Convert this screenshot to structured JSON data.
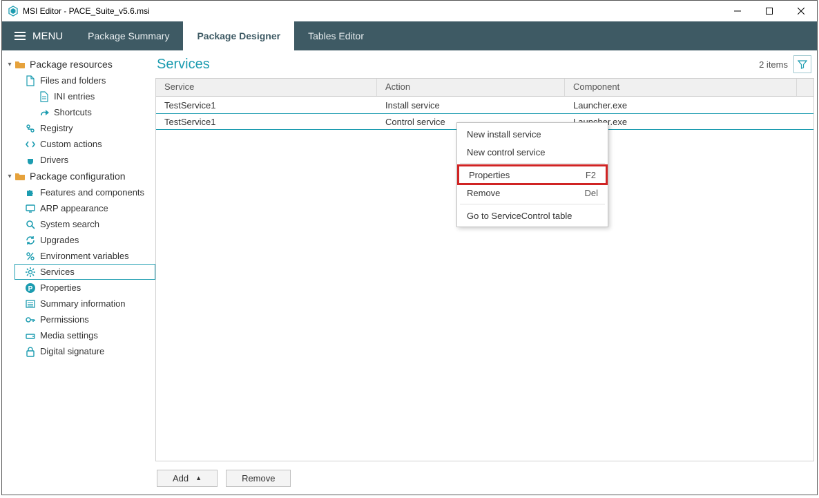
{
  "window": {
    "title": "MSI Editor - PACE_Suite_v5.6.msi"
  },
  "menubar": {
    "menu_label": "MENU",
    "tabs": [
      {
        "label": "Package Summary"
      },
      {
        "label": "Package Designer"
      },
      {
        "label": "Tables Editor"
      }
    ],
    "active_tab_index": 1
  },
  "sidebar": {
    "groups": [
      {
        "label": "Package resources",
        "items": [
          {
            "label": "Files and folders",
            "icon": "file"
          },
          {
            "label": "INI entries",
            "icon": "ini",
            "sub": true
          },
          {
            "label": "Shortcuts",
            "icon": "shortcut",
            "sub": true
          },
          {
            "label": "Registry",
            "icon": "registry"
          },
          {
            "label": "Custom actions",
            "icon": "code"
          },
          {
            "label": "Drivers",
            "icon": "plug"
          }
        ]
      },
      {
        "label": "Package configuration",
        "items": [
          {
            "label": "Features and components",
            "icon": "puzzle"
          },
          {
            "label": "ARP appearance",
            "icon": "monitor"
          },
          {
            "label": "System search",
            "icon": "search"
          },
          {
            "label": "Upgrades",
            "icon": "refresh"
          },
          {
            "label": "Environment variables",
            "icon": "percent"
          },
          {
            "label": "Services",
            "icon": "gear",
            "selected": true
          },
          {
            "label": "Properties",
            "icon": "p"
          },
          {
            "label": "Summary information",
            "icon": "list"
          },
          {
            "label": "Permissions",
            "icon": "key"
          },
          {
            "label": "Media settings",
            "icon": "drive"
          },
          {
            "label": "Digital signature",
            "icon": "lock"
          }
        ]
      }
    ]
  },
  "main": {
    "title": "Services",
    "items_count_label": "2 items",
    "columns": {
      "service": "Service",
      "action": "Action",
      "component": "Component"
    },
    "rows": [
      {
        "service": "TestService1",
        "action": "Install service",
        "component": "Launcher.exe"
      },
      {
        "service": "TestService1",
        "action": "Control service",
        "component": "Launcher.exe"
      }
    ],
    "selected_row_index": 1
  },
  "footer": {
    "add_label": "Add",
    "remove_label": "Remove"
  },
  "context_menu": {
    "items": [
      {
        "label": "New install service",
        "shortcut": ""
      },
      {
        "label": "New control service",
        "shortcut": ""
      },
      {
        "sep": true
      },
      {
        "label": "Properties",
        "shortcut": "F2",
        "highlight": true
      },
      {
        "label": "Remove",
        "shortcut": "Del"
      },
      {
        "sep": true
      },
      {
        "label": "Go to ServiceControl table",
        "shortcut": ""
      }
    ]
  }
}
